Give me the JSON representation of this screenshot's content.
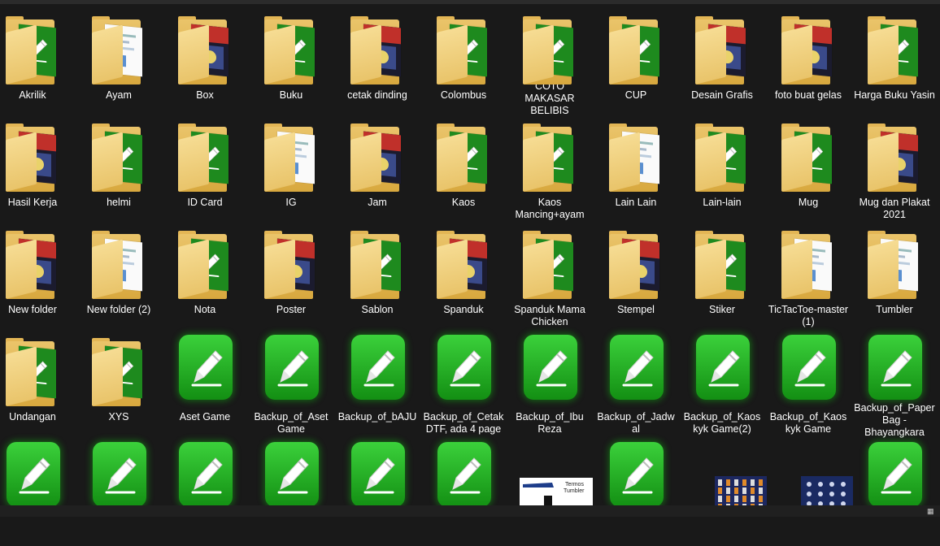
{
  "window": {
    "title": ""
  },
  "items": [
    {
      "label": "Akrilik",
      "kind": "folder-app"
    },
    {
      "label": "Ayam",
      "kind": "folder-doc"
    },
    {
      "label": "Box",
      "kind": "folder-img"
    },
    {
      "label": "Buku",
      "kind": "folder-app"
    },
    {
      "label": "cetak dinding",
      "kind": "folder-img"
    },
    {
      "label": "Colombus",
      "kind": "folder-app"
    },
    {
      "label": "COTO MAKASAR BELIBIS",
      "kind": "folder-app"
    },
    {
      "label": "CUP",
      "kind": "folder-app"
    },
    {
      "label": "Desain Grafis",
      "kind": "folder-img"
    },
    {
      "label": "foto buat gelas",
      "kind": "folder-img"
    },
    {
      "label": "Harga Buku Yasin",
      "kind": "folder-app"
    },
    {
      "label": "Hasil Kerja",
      "kind": "folder-img"
    },
    {
      "label": "helmi",
      "kind": "folder-app"
    },
    {
      "label": "ID Card",
      "kind": "folder-app"
    },
    {
      "label": "IG",
      "kind": "folder-doc"
    },
    {
      "label": "Jam",
      "kind": "folder-img"
    },
    {
      "label": "Kaos",
      "kind": "folder-app"
    },
    {
      "label": "Kaos Mancing+ayam",
      "kind": "folder-app"
    },
    {
      "label": "Lain Lain",
      "kind": "folder-doc"
    },
    {
      "label": "Lain-lain",
      "kind": "folder-app"
    },
    {
      "label": "Mug",
      "kind": "folder-app"
    },
    {
      "label": "Mug dan Plakat 2021",
      "kind": "folder-img"
    },
    {
      "label": "New folder",
      "kind": "folder-img"
    },
    {
      "label": "New folder (2)",
      "kind": "folder-doc"
    },
    {
      "label": "Nota",
      "kind": "folder-app"
    },
    {
      "label": "Poster",
      "kind": "folder-img"
    },
    {
      "label": "Sablon",
      "kind": "folder-app"
    },
    {
      "label": "Spanduk",
      "kind": "folder-img"
    },
    {
      "label": "Spanduk Mama Chicken",
      "kind": "folder-app"
    },
    {
      "label": "Stempel",
      "kind": "folder-img"
    },
    {
      "label": "Stiker",
      "kind": "folder-app"
    },
    {
      "label": "TicTacToe-master (1)",
      "kind": "folder-doc"
    },
    {
      "label": "Tumbler",
      "kind": "folder-doc"
    },
    {
      "label": "Undangan",
      "kind": "folder-app"
    },
    {
      "label": "XYS",
      "kind": "folder-app"
    },
    {
      "label": "Aset Game",
      "kind": "app"
    },
    {
      "label": "Backup_of_Aset Game",
      "kind": "app"
    },
    {
      "label": "Backup_of_bAJU",
      "kind": "app"
    },
    {
      "label": "Backup_of_Cetak DTF, ada 4 page",
      "kind": "app"
    },
    {
      "label": "Backup_of_Ibu Reza",
      "kind": "app"
    },
    {
      "label": "Backup_of_Jadwal",
      "kind": "app"
    },
    {
      "label": "Backup_of_Kaos kyk Game(2)",
      "kind": "app"
    },
    {
      "label": "Backup_of_Kaos kyk Game",
      "kind": "app"
    },
    {
      "label": "Backup_of_Paper Bag - Bhayangkara",
      "kind": "app"
    },
    {
      "label": "",
      "kind": "app"
    },
    {
      "label": "",
      "kind": "app"
    },
    {
      "label": "",
      "kind": "app"
    },
    {
      "label": "",
      "kind": "app"
    },
    {
      "label": "",
      "kind": "app"
    },
    {
      "label": "",
      "kind": "app"
    },
    {
      "label": "",
      "kind": "image-termos",
      "thumb_text": "Termos Tumbler"
    },
    {
      "label": "",
      "kind": "app"
    },
    {
      "label": "",
      "kind": "image-grid"
    },
    {
      "label": "",
      "kind": "image-grid2"
    },
    {
      "label": "",
      "kind": "app"
    }
  ],
  "colors": {
    "background": "#191919",
    "app_green": "#2fbf2f",
    "folder_yellow": "#e9c46a",
    "text": "#ffffff"
  },
  "icons": {
    "folder": "folder-icon",
    "app": "coreldraw-file-icon",
    "view": "details-view-icon"
  }
}
